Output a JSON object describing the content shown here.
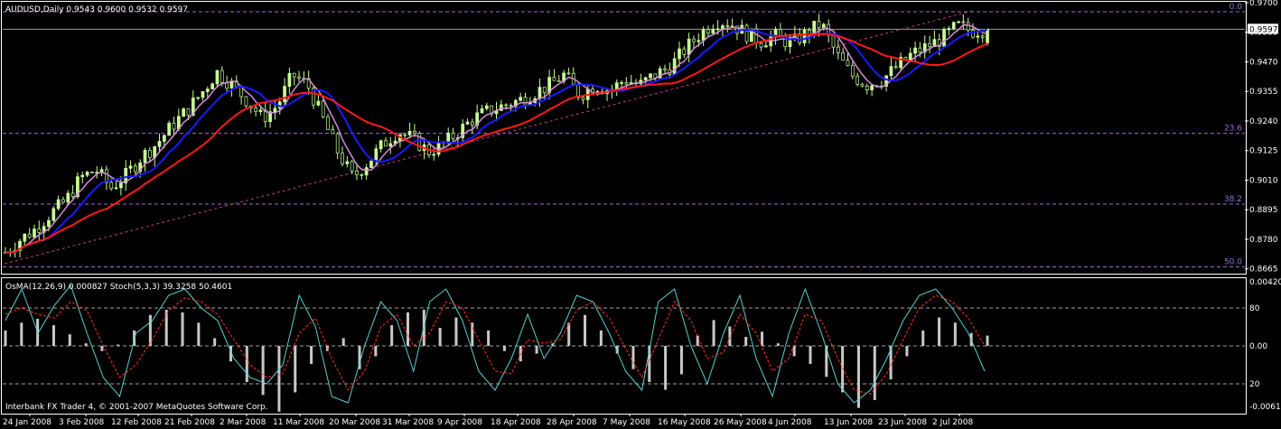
{
  "header": {
    "title": "AUDUSD,Daily  0.9543 0.9600 0.9532 0.9597",
    "indicator_label": "OsMA(12,26,9) 0.000827   Stoch(5,3,3) 39.3258 50.4601",
    "copyright": "Interbank FX Trader 4, © 2001-2007 MetaQuotes Software Corp."
  },
  "colors": {
    "background": "#000000",
    "frame": "#ffffff",
    "bull_candle": "#c8ff96",
    "bear_candle": "#000000",
    "wick": "#c8ff96",
    "ma_fast": "#d48cd9",
    "ma_mid": "#1a1aff",
    "ma_slow": "#ff1a1a",
    "fib_line": "#9b6dd6",
    "trendline": "#c04080",
    "osma_bar": "#c8c8c8",
    "stoch_main": "#5ad0d0",
    "stoch_signal": "#ff3030",
    "level_line": "#a0a0a0"
  },
  "chart_data": [
    {
      "type": "candlestick",
      "name": "AUDUSD,Daily",
      "ohlc_current": {
        "open": 0.9543,
        "high": 0.96,
        "low": 0.9532,
        "close": 0.9597
      },
      "current_price_label": "0.9597",
      "ylim": [
        0.865,
        0.97
      ],
      "y_ticks": [
        "0.9700",
        "0.9585",
        "0.9470",
        "0.9355",
        "0.9240",
        "0.9125",
        "0.9010",
        "0.8895",
        "0.8780",
        "0.8665"
      ],
      "fib_levels": [
        {
          "label": "0.0",
          "value": 0.9665
        },
        {
          "label": "23.6",
          "value": 0.9192
        },
        {
          "label": "38.2",
          "value": 0.8917
        },
        {
          "label": "50.0",
          "value": 0.8673
        }
      ],
      "x_ticks": [
        "24 Jan 2008",
        "3 Feb 2008",
        "12 Feb 2008",
        "21 Feb 2008",
        "2 Mar 2008",
        "11 Mar 2008",
        "20 Mar 2008",
        "31 Mar 2008",
        "9 Apr 2008",
        "18 Apr 2008",
        "28 Apr 2008",
        "7 May 2008",
        "16 May 2008",
        "26 May 2008",
        "4 Jun 2008",
        "13 Jun 2008",
        "23 Jun 2008",
        "2 Jul 2008"
      ],
      "close_path": [
        0.873,
        0.878,
        0.882,
        0.888,
        0.893,
        0.902,
        0.905,
        0.898,
        0.903,
        0.91,
        0.915,
        0.922,
        0.928,
        0.935,
        0.943,
        0.938,
        0.932,
        0.925,
        0.93,
        0.942,
        0.938,
        0.925,
        0.912,
        0.902,
        0.908,
        0.915,
        0.92,
        0.917,
        0.912,
        0.915,
        0.92,
        0.925,
        0.928,
        0.93,
        0.932,
        0.935,
        0.938,
        0.942,
        0.934,
        0.938,
        0.936,
        0.94,
        0.938,
        0.942,
        0.945,
        0.952,
        0.958,
        0.963,
        0.962,
        0.958,
        0.955,
        0.957,
        0.954,
        0.958,
        0.962,
        0.95,
        0.942,
        0.938,
        0.94,
        0.945,
        0.95,
        0.953,
        0.956,
        0.961,
        0.959,
        0.9597
      ]
    },
    {
      "type": "bar",
      "name": "OsMA(12,26,9)",
      "value_current": 0.000827,
      "y_ticks": [
        "0.00420",
        "0.00",
        "-0.00612"
      ],
      "ylim": [
        -0.00612,
        0.0042
      ],
      "values": [
        0.0012,
        0.0018,
        0.0021,
        0.0016,
        0.0009,
        0.0002,
        -0.0004,
        0.0001,
        0.0012,
        0.0024,
        0.0028,
        0.0026,
        0.0018,
        0.0006,
        -0.0012,
        -0.0028,
        -0.0038,
        -0.0051,
        -0.0036,
        -0.0014,
        -0.0004,
        0.0006,
        -0.0018,
        -0.0008,
        0.0016,
        0.0026,
        0.0028,
        0.0014,
        0.0022,
        0.0018,
        0.0012,
        -0.0004,
        -0.0012,
        -0.0006,
        0.0002,
        0.0018,
        0.0024,
        0.0012,
        -0.0006,
        -0.0018,
        -0.0028,
        -0.0034,
        -0.0022,
        0.0008,
        0.002,
        0.0015,
        0.0007,
        0.0011,
        0.0002,
        -0.0008,
        -0.0014,
        -0.0024,
        -0.0036,
        -0.0048,
        -0.0042,
        -0.0026,
        -0.0008,
        0.0012,
        0.0022,
        0.0018,
        0.001,
        0.0008
      ],
      "levels": [
        {
          "label": "80",
          "value": 80
        },
        {
          "label": "0.00",
          "value": 50
        },
        {
          "label": "20",
          "value": 20
        }
      ]
    },
    {
      "type": "line",
      "name": "Stoch(5,3,3)",
      "main_current": 39.3258,
      "signal_current": 50.4601,
      "ylim": [
        0,
        100
      ],
      "main": [
        70,
        95,
        60,
        82,
        98,
        60,
        25,
        10,
        60,
        70,
        90,
        95,
        80,
        70,
        40,
        25,
        20,
        35,
        90,
        65,
        10,
        5,
        50,
        85,
        70,
        30,
        85,
        95,
        70,
        30,
        15,
        40,
        75,
        40,
        60,
        90,
        85,
        60,
        30,
        15,
        85,
        95,
        50,
        20,
        60,
        90,
        40,
        10,
        60,
        95,
        60,
        20,
        5,
        15,
        40,
        70,
        90,
        95,
        80,
        60,
        30
      ],
      "signal": [
        75,
        80,
        75,
        72,
        85,
        78,
        50,
        25,
        35,
        55,
        78,
        88,
        85,
        75,
        55,
        35,
        25,
        28,
        60,
        72,
        40,
        15,
        30,
        65,
        75,
        50,
        60,
        85,
        80,
        55,
        30,
        28,
        55,
        52,
        55,
        78,
        85,
        72,
        48,
        25,
        55,
        85,
        70,
        40,
        45,
        75,
        60,
        30,
        40,
        75,
        70,
        40,
        15,
        12,
        28,
        55,
        80,
        90,
        85,
        72,
        50
      ]
    }
  ]
}
